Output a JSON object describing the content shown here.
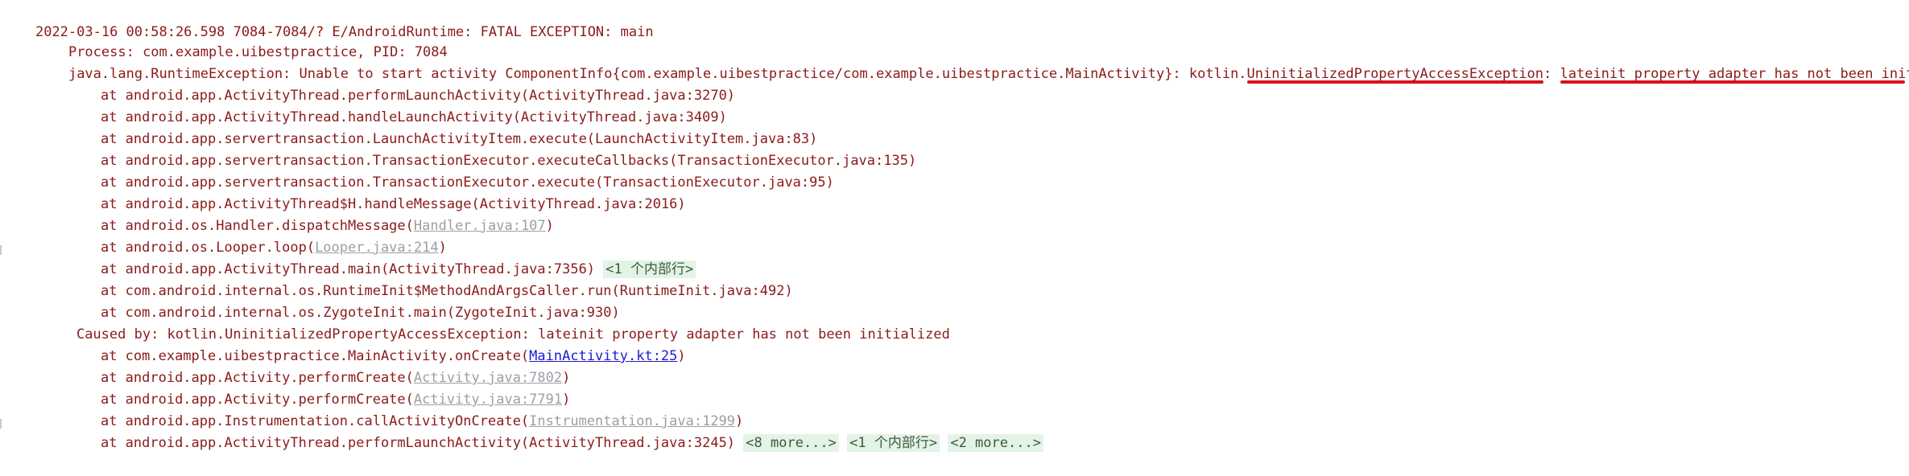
{
  "log": {
    "header": "2022-03-16 00:58:26.598 7084-7084/? E/AndroidRuntime: FATAL EXCEPTION: main",
    "process": "Process: com.example.uibestpractice, PID: 7084",
    "exception": {
      "prefix": "java.lang.RuntimeException: Unable to start activity ComponentInfo{com.example.uibestpractice/com.example.uibestpractice.MainActivity}: kotlin.",
      "type": "UninitializedPropertyAccessException",
      "sep": ": ",
      "message": "lateinit property adapter has not been initialized"
    },
    "frames1": [
      {
        "text": "at android.app.ActivityThread.performLaunchActivity(ActivityThread.java:3270)"
      },
      {
        "text": "at android.app.ActivityThread.handleLaunchActivity(ActivityThread.java:3409)"
      },
      {
        "text": "at android.app.servertransaction.LaunchActivityItem.execute(LaunchActivityItem.java:83)"
      },
      {
        "text": "at android.app.servertransaction.TransactionExecutor.executeCallbacks(TransactionExecutor.java:135)"
      },
      {
        "text": "at android.app.servertransaction.TransactionExecutor.execute(TransactionExecutor.java:95)"
      },
      {
        "text": "at android.app.ActivityThread$H.handleMessage(ActivityThread.java:2016)"
      }
    ],
    "handler_frame": {
      "pre": "at android.os.Handler.dispatchMessage(",
      "link": "Handler.java:107",
      "post": ")"
    },
    "looper_frame": {
      "pre": "at android.os.Looper.loop(",
      "link": "Looper.java:214",
      "post": ")"
    },
    "main_frame": {
      "text": "at android.app.ActivityThread.main(ActivityThread.java:7356)",
      "fold": "<1 个内部行>"
    },
    "frames2": [
      {
        "text": "at com.android.internal.os.RuntimeInit$MethodAndArgsCaller.run(RuntimeInit.java:492)"
      },
      {
        "text": "at com.android.internal.os.ZygoteInit.main(ZygoteInit.java:930)"
      }
    ],
    "caused_by": "Caused by: kotlin.UninitializedPropertyAccessException: lateinit property adapter has not been initialized",
    "oncreate_frame": {
      "pre": "at com.example.uibestpractice.MainActivity.onCreate(",
      "link": "MainActivity.kt:25",
      "post": ")"
    },
    "perform1_frame": {
      "pre": "at android.app.Activity.performCreate(",
      "link": "Activity.java:7802",
      "post": ")"
    },
    "perform2_frame": {
      "pre": "at android.app.Activity.performCreate(",
      "link": "Activity.java:7791",
      "post": ")"
    },
    "instr_frame": {
      "pre": "at android.app.Instrumentation.callActivityOnCreate(",
      "link": "Instrumentation.java:1299",
      "post": ")"
    },
    "last_frame": {
      "text": "at android.app.ActivityThread.performLaunchActivity(ActivityThread.java:3245)",
      "fold1": "<8 more...>",
      "fold2": "<1 个内部行>",
      "fold3": "<2 more...>"
    }
  },
  "colors": {
    "error_text": "#8b1a1a",
    "annotation": "#d8111b",
    "hyperlink": "#1a1ad6",
    "dim_link": "#9aa0a6",
    "fold_bg": "#e3f3e6"
  }
}
